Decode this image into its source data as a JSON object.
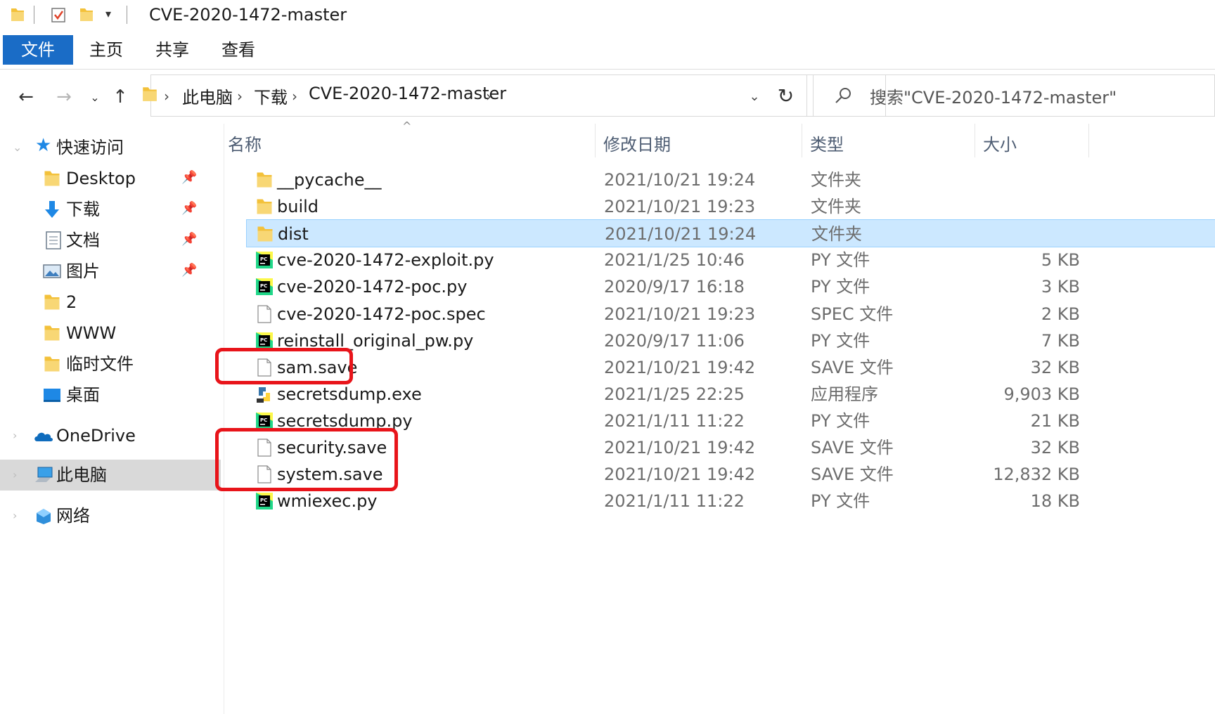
{
  "window": {
    "title": "CVE-2020-1472-master"
  },
  "quick_access_toolbar": {
    "icons": [
      "folder-icon",
      "properties-icon",
      "new-folder-icon",
      "customize-dropdown-icon"
    ]
  },
  "ribbon": {
    "tabs": [
      {
        "label": "文件",
        "active": true
      },
      {
        "label": "主页"
      },
      {
        "label": "共享"
      },
      {
        "label": "查看"
      }
    ],
    "file_tab_color": "#1a6cc6"
  },
  "address_bar": {
    "breadcrumbs": [
      "此电脑",
      "下载",
      "CVE-2020-1472-master"
    ]
  },
  "search": {
    "placeholder": "搜索\"CVE-2020-1472-master\""
  },
  "sidebar": {
    "quick_access_label": "快速访问",
    "items": [
      {
        "label": "Desktop",
        "icon": "folder-icon",
        "pinned": true
      },
      {
        "label": "下载",
        "icon": "download-arrow-icon",
        "pinned": true
      },
      {
        "label": "文档",
        "icon": "document-icon",
        "pinned": true
      },
      {
        "label": "图片",
        "icon": "pictures-icon",
        "pinned": true
      },
      {
        "label": "2",
        "icon": "folder-icon",
        "pinned": false
      },
      {
        "label": "WWW",
        "icon": "folder-icon",
        "pinned": false
      },
      {
        "label": "临时文件",
        "icon": "folder-icon",
        "pinned": false
      },
      {
        "label": "桌面",
        "icon": "desktop-icon",
        "pinned": false
      }
    ],
    "onedrive_label": "OneDrive",
    "this_pc_label": "此电脑",
    "network_label": "网络"
  },
  "columns": {
    "name": "名称",
    "date": "修改日期",
    "type": "类型",
    "size": "大小"
  },
  "files": [
    {
      "name": "__pycache__",
      "date": "2021/10/21 19:24",
      "type": "文件夹",
      "size": "",
      "icon": "folder-icon"
    },
    {
      "name": "build",
      "date": "2021/10/21 19:23",
      "type": "文件夹",
      "size": "",
      "icon": "folder-icon"
    },
    {
      "name": "dist",
      "date": "2021/10/21 19:24",
      "type": "文件夹",
      "size": "",
      "icon": "folder-icon",
      "selected": true
    },
    {
      "name": "cve-2020-1472-exploit.py",
      "date": "2021/1/25 10:46",
      "type": "PY 文件",
      "size": "5 KB",
      "icon": "pycharm-file-icon"
    },
    {
      "name": "cve-2020-1472-poc.py",
      "date": "2020/9/17 16:18",
      "type": "PY 文件",
      "size": "3 KB",
      "icon": "pycharm-file-icon"
    },
    {
      "name": "cve-2020-1472-poc.spec",
      "date": "2021/10/21 19:23",
      "type": "SPEC 文件",
      "size": "2 KB",
      "icon": "blank-file-icon"
    },
    {
      "name": "reinstall_original_pw.py",
      "date": "2020/9/17 11:06",
      "type": "PY 文件",
      "size": "7 KB",
      "icon": "pycharm-file-icon"
    },
    {
      "name": "sam.save",
      "date": "2021/10/21 19:42",
      "type": "SAVE 文件",
      "size": "32 KB",
      "icon": "blank-file-icon"
    },
    {
      "name": "secretsdump.exe",
      "date": "2021/1/25 22:25",
      "type": "应用程序",
      "size": "9,903 KB",
      "icon": "python-exe-icon"
    },
    {
      "name": "secretsdump.py",
      "date": "2021/1/11 11:22",
      "type": "PY 文件",
      "size": "21 KB",
      "icon": "pycharm-file-icon"
    },
    {
      "name": "security.save",
      "date": "2021/10/21 19:42",
      "type": "SAVE 文件",
      "size": "32 KB",
      "icon": "blank-file-icon"
    },
    {
      "name": "system.save",
      "date": "2021/10/21 19:42",
      "type": "SAVE 文件",
      "size": "12,832 KB",
      "icon": "blank-file-icon"
    },
    {
      "name": "wmiexec.py",
      "date": "2021/1/11 11:22",
      "type": "PY 文件",
      "size": "18 KB",
      "icon": "pycharm-file-icon"
    }
  ],
  "annotations": {
    "color": "#e8141a",
    "highlighted_files": [
      "sam.save",
      "security.save",
      "system.save"
    ]
  },
  "selection_color": "#cce8ff"
}
